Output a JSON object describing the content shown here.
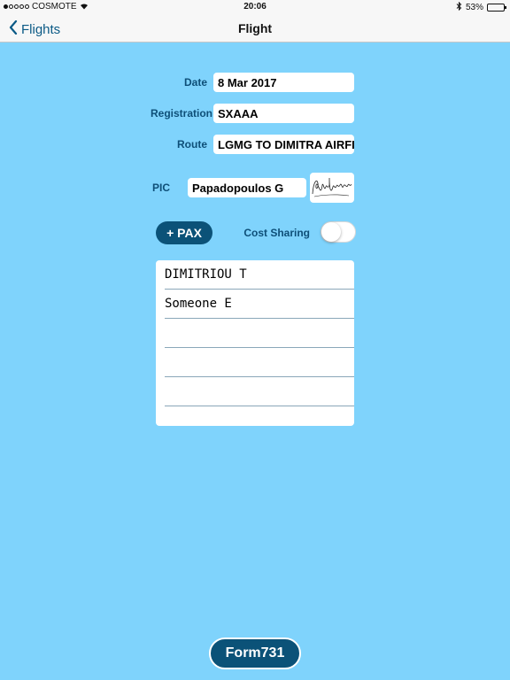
{
  "status": {
    "carrier": "COSMOTE",
    "time": "20:06",
    "battery": "53%",
    "battery_level": 0.53
  },
  "nav": {
    "back_label": "Flights",
    "title": "Flight"
  },
  "form": {
    "date_label": "Date",
    "date_value": "8 Mar 2017",
    "registration_label": "Registration",
    "registration_value": "SXAAA",
    "route_label": "Route",
    "route_value": "LGMG TO DIMITRA AIRFIELD",
    "pic_label": "PIC",
    "pic_value": "Papadopoulos G"
  },
  "pax": {
    "add_label": "+ PAX",
    "cost_sharing_label": "Cost Sharing",
    "cost_sharing_on": false,
    "passengers": [
      "DIMITRIOU T",
      "Someone E",
      "",
      "",
      ""
    ]
  },
  "footer": {
    "form_button_label": "Form731"
  },
  "colors": {
    "background": "#7fd3fc",
    "button": "#0b5278",
    "label": "#0e4f78"
  },
  "icons": {
    "back": "chevron-left-icon",
    "wifi": "wifi-icon",
    "bluetooth": "bluetooth-icon",
    "battery": "battery-icon"
  }
}
